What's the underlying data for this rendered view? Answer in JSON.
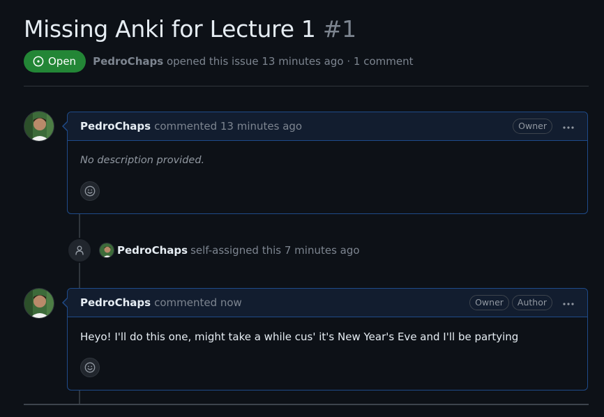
{
  "issue": {
    "title": "Missing Anki for Lecture 1",
    "number": "#1",
    "state": "Open",
    "author": "PedroChaps",
    "meta_text": "opened this issue 13 minutes ago · 1 comment"
  },
  "timeline": {
    "comment1": {
      "author": "PedroChaps",
      "action": "commented 13 minutes ago",
      "badges": [
        "Owner"
      ],
      "body": "No description provided."
    },
    "event": {
      "author": "PedroChaps",
      "text": "self-assigned this 7 minutes ago"
    },
    "comment2": {
      "author": "PedroChaps",
      "action": "commented now",
      "badges": [
        "Owner",
        "Author"
      ],
      "body": "Heyo! I'll do this one, might take a while cus' it's New Year's Eve and I'll be partying"
    }
  },
  "colors": {
    "background": "#0d1117",
    "open_green": "#238636",
    "accent_border": "#1f4b8a",
    "muted_text": "#7d8590"
  },
  "icons": {
    "state": "issue-opened-icon",
    "reaction": "smiley-icon",
    "event": "person-icon",
    "menu": "kebab-horizontal-icon"
  }
}
